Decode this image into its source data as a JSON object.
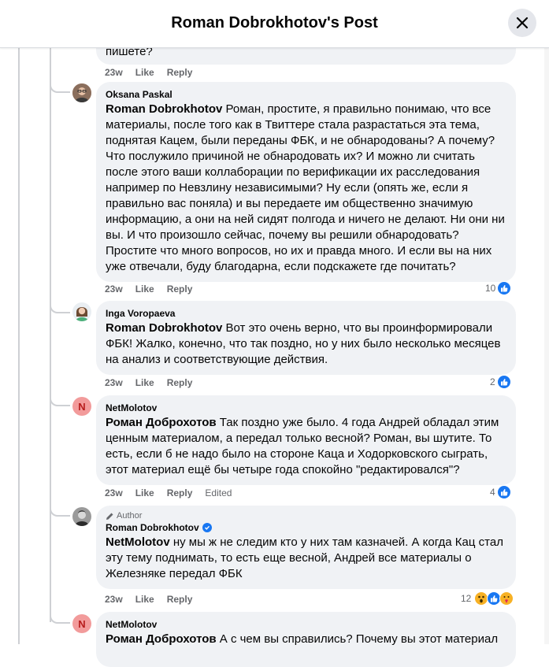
{
  "header": {
    "title": "Roman Dobrokhotov's Post"
  },
  "actions": {
    "like": "Like",
    "reply": "Reply",
    "edited": "Edited"
  },
  "comments": [
    {
      "text_tail": "пишете?",
      "time": "23w"
    },
    {
      "author": "Oksana Paskal",
      "mention": "Roman Dobrokhotov",
      "text": "Роман, простите, я правильно понимаю, что все материалы, после того как в Твиттере стала разрастаться эта тема, поднятая Кацем, были переданы ФБК, и не обнародованы? А почему? Что послужило причиной не обнародовать их? И можно ли считать после этого ваши коллаборации по верификации их расследования например по Невзлину независимыми? Ну если (опять же, если я правильно вас поняла) и вы передаете им общественно значимую информацию, а они на ней сидят полгода и ничего не делают. Ни они ни вы. И что произошло сейчас, почему вы решили обнародовать? Простите что много вопросов, но их и правда много. И если вы на них уже отвечали, буду благодарна, если подскажете где почитать?",
      "time": "23w",
      "reactions": "10"
    },
    {
      "author": "Inga Voropaeva",
      "mention": "Roman Dobrokhotov",
      "text": "Вот это очень верно, что вы проинформировали ФБК! Жалко, конечно, что так поздно, но у них было несколько месяцев на анализ и соответствующие действия.",
      "time": "23w",
      "reactions": "2"
    },
    {
      "author": "NetMolotov",
      "avatar_letter": "N",
      "mention": "Роман Доброхотов",
      "text": "Так поздно уже было. 4 года Андрей обладал этим ценным материалом, а передал только весной? Роман, вы шутите. То есть, если б не надо было на стороне Каца и Ходорковского сыграть, этот материал ещё бы четыре года спокойно \"редактировался\"?",
      "time": "23w",
      "reactions": "4"
    },
    {
      "author_badge": "Author",
      "author": "Roman Dobrokhotov",
      "mention": "NetMolotov",
      "text": "ну мы ж не следим кто у них там казначей. А когда Кац стал эту тему поднимать, то есть еще весной, Андрей все материалы о Железняке передал ФБК",
      "time": "23w",
      "reactions": "12"
    },
    {
      "author": "NetMolotov",
      "avatar_letter": "N",
      "mention": "Роман Доброхотов",
      "text": "А с чем вы справились? Почему вы этот материал"
    }
  ],
  "colors": {
    "like": "#1877f2",
    "bubble": "#f0f2f5",
    "meta": "#65676b"
  }
}
